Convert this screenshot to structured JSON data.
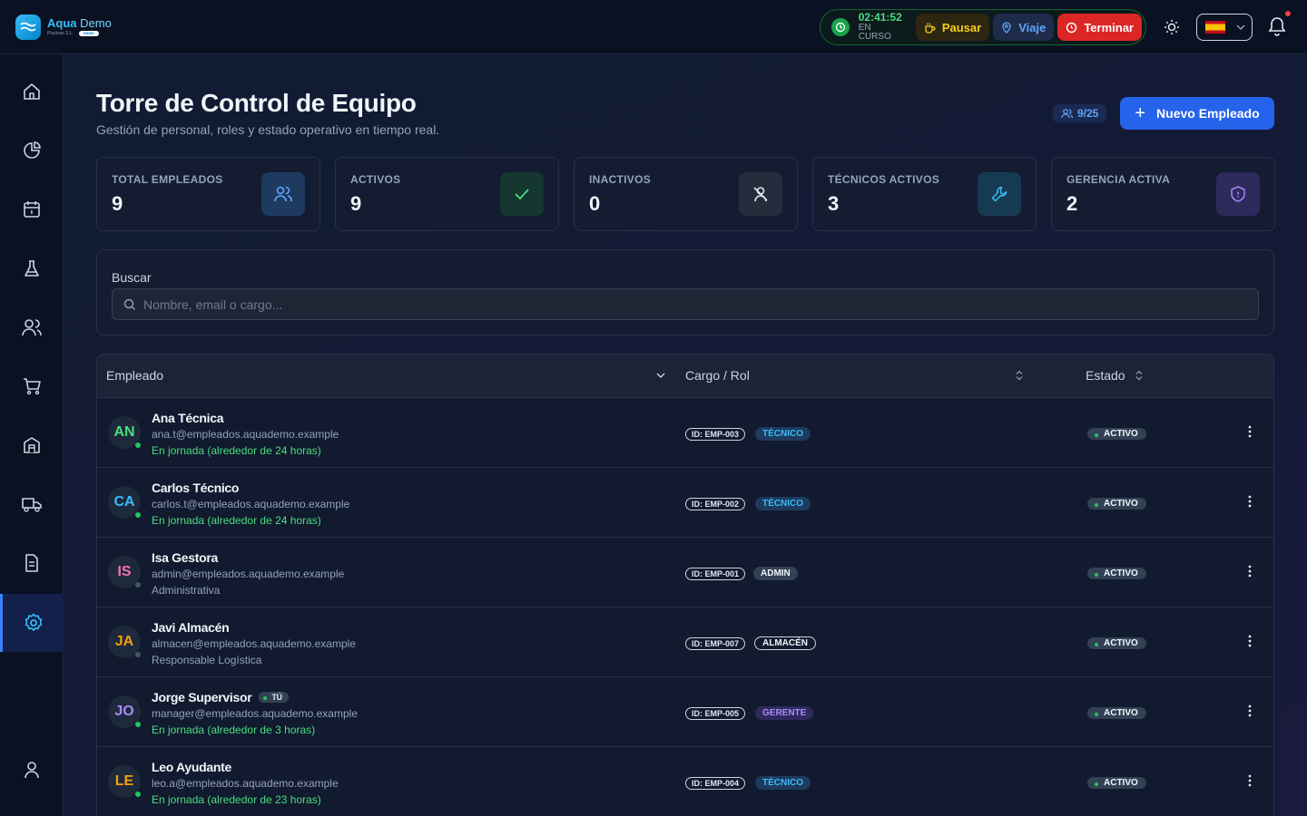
{
  "brand": {
    "name": "Aqua",
    "name_suffix": "Demo",
    "subtitle": "Piscinas S.L.",
    "badge": "DEMO"
  },
  "shift": {
    "time": "02:41:52",
    "status": "EN CURSO",
    "pause_label": "Pausar",
    "trip_label": "Viaje",
    "end_label": "Terminar"
  },
  "colors": {
    "accent": "#2563eb",
    "success": "#22c55e",
    "danger": "#dc2626",
    "warning": "#facc15"
  },
  "page": {
    "title": "Torre de Control de Equipo",
    "subtitle": "Gestión de personal, roles y estado operativo en tiempo real.",
    "capacity": "9/25",
    "new_button": "Nuevo Empleado"
  },
  "stats": [
    {
      "label": "TOTAL EMPLEADOS",
      "value": "9",
      "icon": "users-icon"
    },
    {
      "label": "ACTIVOS",
      "value": "9",
      "icon": "check-icon"
    },
    {
      "label": "INACTIVOS",
      "value": "0",
      "icon": "user-off-icon"
    },
    {
      "label": "TÉCNICOS ACTIVOS",
      "value": "3",
      "icon": "wrench-icon"
    },
    {
      "label": "GERENCIA ACTIVA",
      "value": "2",
      "icon": "shield-icon"
    }
  ],
  "search": {
    "label": "Buscar",
    "placeholder": "Nombre, email o cargo..."
  },
  "table": {
    "columns": [
      "Empleado",
      "Cargo / Rol",
      "Estado"
    ],
    "rows": [
      {
        "initials": "AN",
        "name": "Ana Técnica",
        "email": "ana.t@empleados.aquademo.example",
        "status": "En jornada (alrededor de 24 horas)",
        "id": "ID: EMP-003",
        "role": "TÉCNICO",
        "state": "ACTIVO"
      },
      {
        "initials": "CA",
        "name": "Carlos Técnico",
        "email": "carlos.t@empleados.aquademo.example",
        "status": "En jornada (alrededor de 24 horas)",
        "id": "ID: EMP-002",
        "role": "TÉCNICO",
        "state": "ACTIVO"
      },
      {
        "initials": "IS",
        "name": "Isa Gestora",
        "email": "admin@empleados.aquademo.example",
        "status": "Administrativa",
        "id": "ID: EMP-001",
        "role": "ADMIN",
        "state": "ACTIVO"
      },
      {
        "initials": "JA",
        "name": "Javi Almacén",
        "email": "almacen@empleados.aquademo.example",
        "status": "Responsable Logística",
        "id": "ID: EMP-007",
        "role": "ALMACÉN",
        "state": "ACTIVO"
      },
      {
        "initials": "JO",
        "name": "Jorge Supervisor",
        "you": "TÚ",
        "email": "manager@empleados.aquademo.example",
        "status": "En jornada (alrededor de 3 horas)",
        "id": "ID: EMP-005",
        "role": "GERENTE",
        "state": "ACTIVO"
      },
      {
        "initials": "LE",
        "name": "Leo Ayudante",
        "email": "leo.a@empleados.aquademo.example",
        "status": "En jornada (alrededor de 23 horas)",
        "id": "ID: EMP-004",
        "role": "TÉCNICO",
        "state": "ACTIVO"
      }
    ]
  },
  "sidebar": [
    "home-icon",
    "chart-pie-icon",
    "calendar-icon",
    "flask-icon",
    "users-icon",
    "cart-icon",
    "building-icon",
    "truck-icon",
    "document-icon",
    "settings-icon",
    "user-icon"
  ]
}
